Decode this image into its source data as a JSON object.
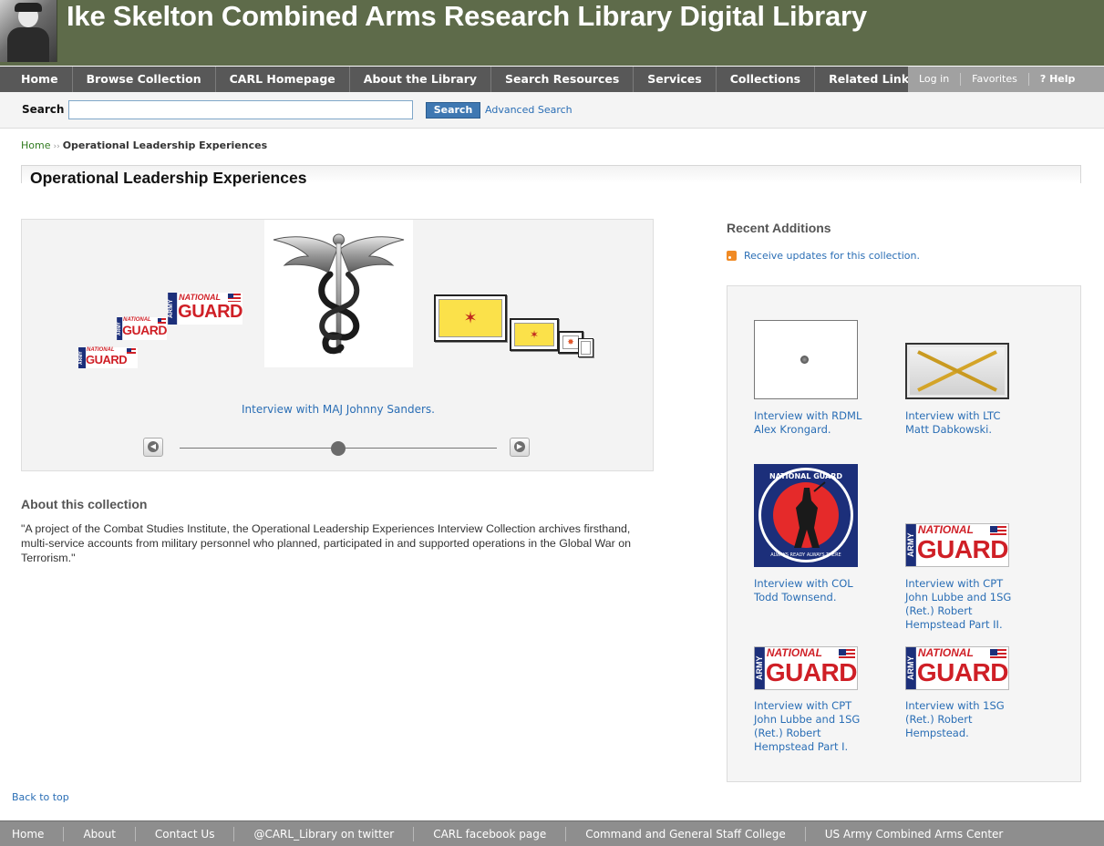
{
  "banner": {
    "title": "Ike Skelton Combined Arms Research Library Digital Library"
  },
  "nav": {
    "items": [
      "Home",
      "Browse Collection",
      "CARL Homepage",
      "About the Library",
      "Search Resources",
      "Services",
      "Collections",
      "Related Links"
    ],
    "utility": [
      "Log in",
      "Favorites",
      "? Help"
    ]
  },
  "search": {
    "label": "Search",
    "button": "Search",
    "value": "",
    "advanced": "Advanced Search"
  },
  "breadcrumb": {
    "home": "Home",
    "separator": "››",
    "current": "Operational Leadership Experiences"
  },
  "page": {
    "title": "Operational Leadership Experiences"
  },
  "carousel": {
    "caption": "Interview with MAJ Johnny Sanders.",
    "position_fraction": 0.5,
    "logo": {
      "army": "ARMY",
      "national": "NATIONAL",
      "guard": "GUARD"
    }
  },
  "about": {
    "heading": "About this collection",
    "text": "\"A project of the Combat Studies Institute, the Operational Leadership Experiences Interview Collection archives firsthand, multi-service accounts from military personnel who planned, participated in and supported operations in the Global War on Terrorism.\""
  },
  "recent": {
    "heading": "Recent Additions",
    "rss": "Receive updates for this collection.",
    "items": [
      {
        "caption": "Interview with RDML Alex Krongard."
      },
      {
        "caption": "Interview with LTC Matt Dabkowski."
      },
      {
        "caption": "Interview with COL Todd Townsend."
      },
      {
        "caption": "Interview with CPT John Lubbe and 1SG (Ret.) Robert Hempstead Part II."
      },
      {
        "caption": "Interview with CPT John Lubbe and 1SG (Ret.) Robert Hempstead Part I."
      },
      {
        "caption": "Interview with 1SG (Ret.) Robert Hempstead."
      }
    ],
    "ng_seal": {
      "top": "NATIONAL GUARD",
      "bottom": "ALWAYS READY ALWAYS THERE"
    }
  },
  "back_to_top": "Back to top",
  "footer": {
    "links": [
      "Home",
      "About",
      "Contact Us",
      "@CARL_Library on twitter",
      "CARL facebook page",
      "Command and General Staff College",
      "US Army Combined Arms Center"
    ]
  },
  "colors": {
    "banner": "#5e6b4a",
    "nav": "#585858",
    "link": "#2a6eb5",
    "guard_red": "#cf1f26",
    "guard_blue": "#1c2f7a"
  }
}
